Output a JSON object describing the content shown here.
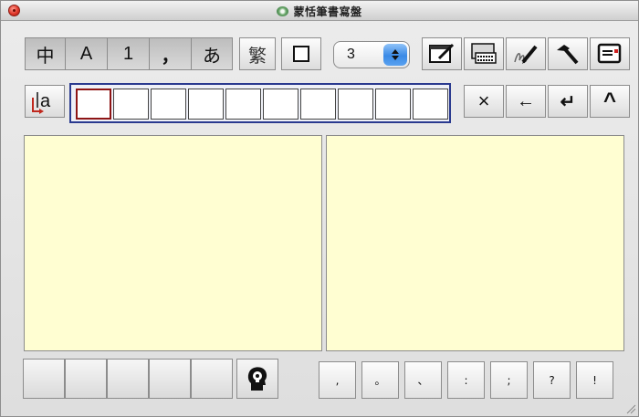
{
  "window": {
    "title": "蒙恬筆書寫盤"
  },
  "toolbar": {
    "modes": [
      {
        "name": "chinese",
        "label": "中"
      },
      {
        "name": "alpha",
        "label": "A"
      },
      {
        "name": "numeric",
        "label": "1"
      },
      {
        "name": "punct",
        "label": "，"
      },
      {
        "name": "japanese",
        "label": "あ"
      }
    ],
    "traditional_label": "繁",
    "candidate_count": "3",
    "tools": [
      "edit-window-icon",
      "keyboard-icon",
      "pen-settings-icon",
      "hammer-icon",
      "notepad-icon"
    ]
  },
  "candidates": {
    "learn_icon_label": "a",
    "cells": [
      "",
      "",
      "",
      "",
      "",
      "",
      "",
      "",
      "",
      ""
    ],
    "actions": [
      {
        "name": "delete",
        "label": "×"
      },
      {
        "name": "backspace",
        "label": "←"
      },
      {
        "name": "enter",
        "label": "↵"
      },
      {
        "name": "up",
        "label": "^"
      }
    ]
  },
  "bottom": {
    "blank_buttons": [
      "",
      "",
      "",
      "",
      ""
    ],
    "punctuation": [
      ",",
      "。",
      "、",
      ":",
      ";",
      "?",
      "!"
    ]
  }
}
